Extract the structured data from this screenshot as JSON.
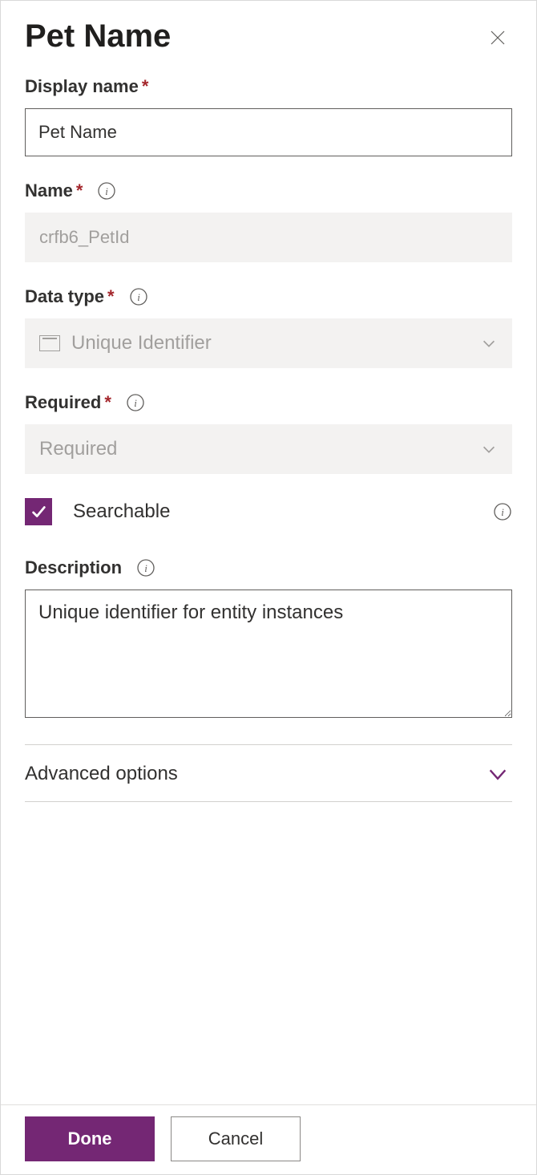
{
  "header": {
    "title": "Pet Name"
  },
  "fields": {
    "displayName": {
      "label": "Display name",
      "value": "Pet Name",
      "required": true
    },
    "name": {
      "label": "Name",
      "value": "crfb6_PetId",
      "required": true
    },
    "dataType": {
      "label": "Data type",
      "value": "Unique Identifier",
      "required": true
    },
    "required": {
      "label": "Required",
      "value": "Required",
      "required": true
    },
    "searchable": {
      "label": "Searchable",
      "checked": true
    },
    "description": {
      "label": "Description",
      "value": "Unique identifier for entity instances"
    }
  },
  "advanced": {
    "label": "Advanced options"
  },
  "footer": {
    "done": "Done",
    "cancel": "Cancel"
  },
  "colors": {
    "accent": "#742774"
  }
}
